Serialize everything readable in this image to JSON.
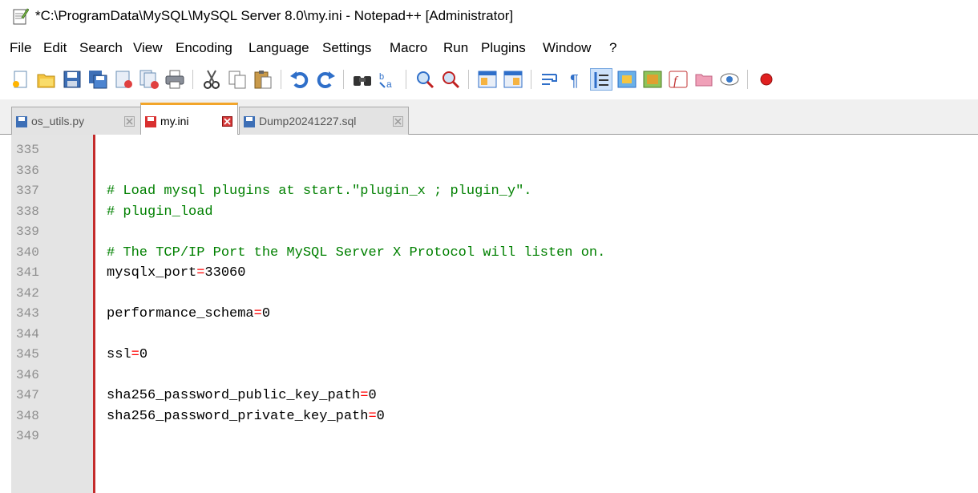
{
  "window": {
    "title": "*C:\\ProgramData\\MySQL\\MySQL Server 8.0\\my.ini - Notepad++ [Administrator]"
  },
  "menu": [
    "File",
    "Edit",
    "Search",
    "View",
    "Encoding",
    "Language",
    "Settings",
    "Macro",
    "Run",
    "Plugins",
    "Window",
    "?"
  ],
  "toolbar": {
    "buttons": [
      "new-file-icon",
      "open-file-icon",
      "save-icon",
      "save-all-icon",
      "close-icon",
      "close-all-icon",
      "print-icon",
      "cut-icon",
      "copy-icon",
      "paste-icon",
      "undo-icon",
      "redo-icon",
      "find-icon",
      "replace-icon",
      "zoom-in-icon",
      "zoom-out-icon",
      "sync-vertical-icon",
      "sync-horizontal-icon",
      "word-wrap-icon",
      "show-all-chars-icon",
      "indent-guide-icon",
      "user-language-icon",
      "doc-map-icon",
      "function-list-icon",
      "folder-workspace-icon",
      "monitor-icon",
      "record-macro-icon"
    ]
  },
  "tabs": [
    {
      "name": "os_utils.py",
      "active": false,
      "saved": true
    },
    {
      "name": "my.ini",
      "active": true,
      "saved": false
    },
    {
      "name": "Dump20241227.sql",
      "active": false,
      "saved": true
    }
  ],
  "editor": {
    "lines": [
      {
        "num": "335",
        "type": "blank",
        "text": ""
      },
      {
        "num": "336",
        "type": "blank",
        "text": ""
      },
      {
        "num": "337",
        "type": "comment",
        "text": "# Load mysql plugins at start.\"plugin_x ; plugin_y\"."
      },
      {
        "num": "338",
        "type": "comment",
        "text": "# plugin_load"
      },
      {
        "num": "339",
        "type": "blank",
        "text": ""
      },
      {
        "num": "340",
        "type": "comment",
        "text": "# The TCP/IP Port the MySQL Server X Protocol will listen on."
      },
      {
        "num": "341",
        "type": "kv",
        "key": "mysqlx_port",
        "value": "33060"
      },
      {
        "num": "342",
        "type": "blank",
        "text": ""
      },
      {
        "num": "343",
        "type": "kv",
        "key": "performance_schema",
        "value": "0"
      },
      {
        "num": "344",
        "type": "blank",
        "text": ""
      },
      {
        "num": "345",
        "type": "kv",
        "key": "ssl",
        "value": "0"
      },
      {
        "num": "346",
        "type": "blank",
        "text": ""
      },
      {
        "num": "347",
        "type": "kv",
        "key": "sha256_password_public_key_path",
        "value": "0"
      },
      {
        "num": "348",
        "type": "kv",
        "key": "sha256_password_private_key_path",
        "value": "0"
      },
      {
        "num": "349",
        "type": "blank",
        "text": ""
      }
    ]
  },
  "colors": {
    "comment": "#008000",
    "operator": "#ff0000",
    "active_tab_accent": "#f2a52a",
    "margin_line": "#c42b2b",
    "gutter": "#e4e4e4"
  }
}
